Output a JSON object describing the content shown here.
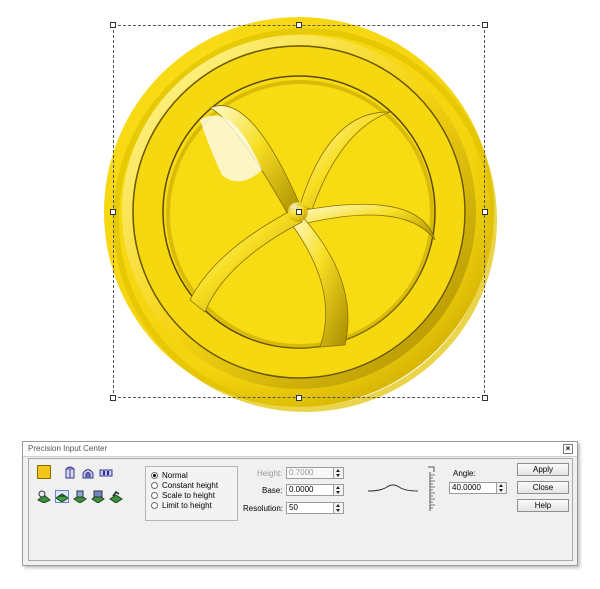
{
  "canvas": {
    "object_color": "#f9dc10",
    "shape_name": "wheel-relief"
  },
  "dialog": {
    "title": "Precision Input Center",
    "close_symbol": "×",
    "color_swatch": "#f2c41a",
    "tools_row1": [
      "extrude-icon",
      "dome-icon",
      "ring-icon"
    ],
    "tools_row2": [
      "relief-tool-1-icon",
      "relief-tool-2-icon",
      "relief-tool-3-icon",
      "relief-tool-4-icon",
      "relief-tool-5-icon"
    ],
    "mode_options": [
      {
        "label": "Normal",
        "selected": true
      },
      {
        "label": "Constant height",
        "selected": false
      },
      {
        "label": "Scale to height",
        "selected": false
      },
      {
        "label": "Limit to height",
        "selected": false
      }
    ],
    "height": {
      "label": "Height:",
      "value": "0.7000"
    },
    "base": {
      "label": "Base:",
      "value": "0.0000"
    },
    "resolution": {
      "label": "Resolution:",
      "value": "50"
    },
    "angle": {
      "label": "Angle:",
      "value": "40.0000"
    },
    "buttons": {
      "apply": "Apply",
      "close": "Close",
      "help": "Help"
    }
  }
}
